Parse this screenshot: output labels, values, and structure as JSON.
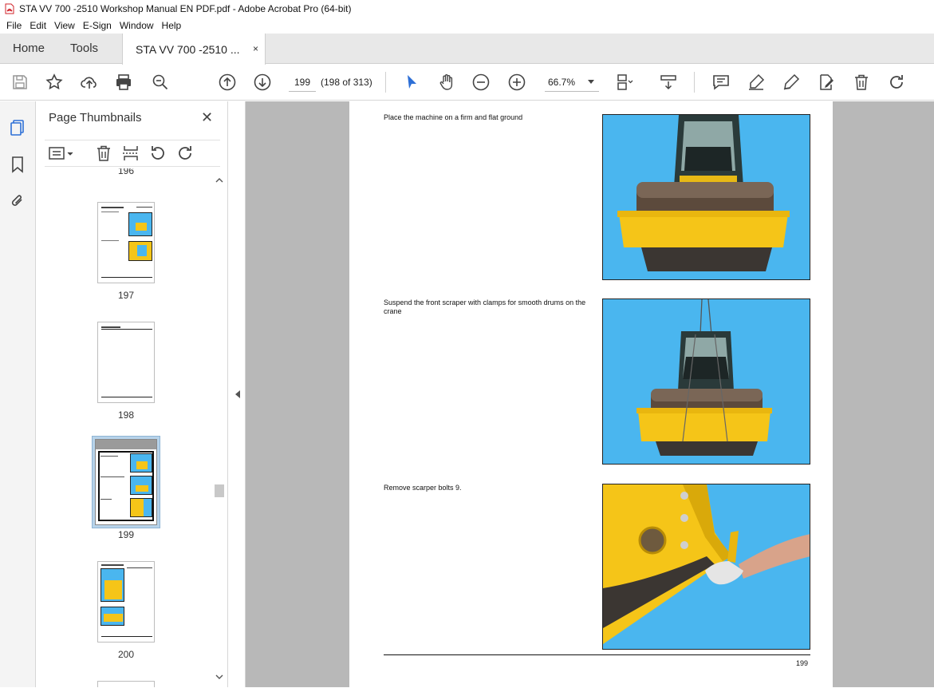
{
  "window": {
    "title": "STA VV 700 -2510 Workshop Manual EN PDF.pdf - Adobe Acrobat Pro (64-bit)"
  },
  "menu": [
    "File",
    "Edit",
    "View",
    "E-Sign",
    "Window",
    "Help"
  ],
  "tabs": {
    "home": "Home",
    "tools": "Tools",
    "document": "STA VV 700 -2510 ...",
    "close": "×"
  },
  "toolbar": {
    "page_number": "199",
    "page_of": "(198 of 313)",
    "zoom": "66.7%"
  },
  "thumbnails_panel": {
    "title": "Page Thumbnails",
    "close": "✕",
    "labels": {
      "p196": "196",
      "p197": "197",
      "p198": "198",
      "p199": "199",
      "p200": "200"
    }
  },
  "page": {
    "steps": [
      {
        "text": "Place the machine on a firm and flat ground"
      },
      {
        "text": "Suspend the front scraper with clamps for smooth drums on the crane"
      },
      {
        "text": "Remove scarper bolts 9."
      }
    ],
    "page_number": "199"
  },
  "colors": {
    "accent": "#2d6fd6",
    "photo_sky": "#4ab6ef",
    "machine_yellow": "#f5c518",
    "thumb_selected": "#b7d3ea"
  }
}
